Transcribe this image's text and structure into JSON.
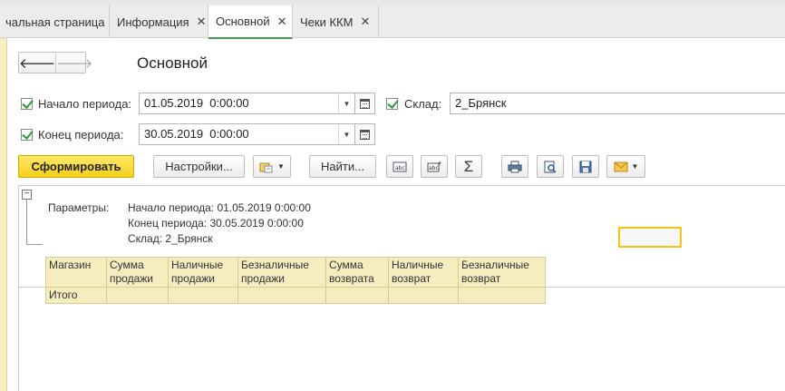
{
  "tabs": [
    {
      "label": "чальная страница",
      "closable": false
    },
    {
      "label": "Информация",
      "closable": true
    },
    {
      "label": "Основной",
      "closable": true,
      "active": true
    },
    {
      "label": "Чеки ККМ",
      "closable": true
    }
  ],
  "close_glyph": "✕",
  "nav": {
    "back": "🡐",
    "forward": "🡒"
  },
  "page_title": "Основной",
  "filters": {
    "start": {
      "label": "Начало периода:",
      "value": "01.05.2019  0:00:00",
      "checked": true
    },
    "end": {
      "label": "Конец периода:",
      "value": "30.05.2019  0:00:00",
      "checked": true
    },
    "warehouse": {
      "label": "Склад:",
      "value": "2_Брянск",
      "checked": true
    }
  },
  "toolbar": {
    "generate": "Сформировать",
    "settings": "Настройки...",
    "find": "Найти...",
    "sum": "Σ"
  },
  "report": {
    "params_label": "Параметры:",
    "params": [
      "Начало периода: 01.05.2019 0:00:00",
      "Конец периода: 30.05.2019 0:00:00",
      "Склад: 2_Брянск"
    ],
    "columns": [
      [
        "Магазин",
        ""
      ],
      [
        "Сумма",
        "продажи"
      ],
      [
        "Наличные",
        "продажи"
      ],
      [
        "Безналичные",
        "продажи"
      ],
      [
        "Сумма",
        "возврата"
      ],
      [
        "Наличные",
        "возврат"
      ],
      [
        "Безналичные",
        "возврат"
      ]
    ],
    "total_label": "Итого"
  },
  "colors": {
    "accent_green": "#3ca04a",
    "primary_button": "#f5cf1c",
    "table_header_bg": "#f5ecc0"
  }
}
